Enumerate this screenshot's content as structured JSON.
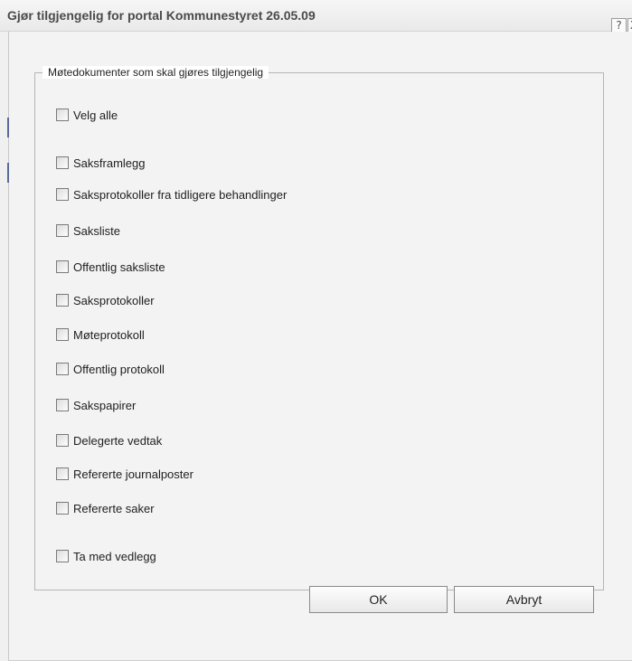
{
  "dialog": {
    "title": "Gjør tilgjengelig for portal Kommunestyret 26.05.09",
    "help_label": "?",
    "close_label": "X"
  },
  "group": {
    "legend": "Møtedokumenter som skal gjøres tilgjengelig"
  },
  "checkboxes": [
    {
      "label": "Velg alle",
      "checked": false
    },
    {
      "label": "Saksframlegg",
      "checked": false
    },
    {
      "label": "Saksprotokoller fra tidligere behandlinger",
      "checked": false
    },
    {
      "label": "Saksliste",
      "checked": false
    },
    {
      "label": "Offentlig saksliste",
      "checked": false
    },
    {
      "label": "Saksprotokoller",
      "checked": false
    },
    {
      "label": "Møteprotokoll",
      "checked": false
    },
    {
      "label": "Offentlig protokoll",
      "checked": false
    },
    {
      "label": "Sakspapirer",
      "checked": false
    },
    {
      "label": "Delegerte vedtak",
      "checked": false
    },
    {
      "label": "Refererte journalposter",
      "checked": false
    },
    {
      "label": "Refererte saker",
      "checked": false
    },
    {
      "label": "Ta med vedlegg",
      "checked": false
    }
  ],
  "buttons": {
    "ok": "OK",
    "cancel": "Avbryt"
  }
}
